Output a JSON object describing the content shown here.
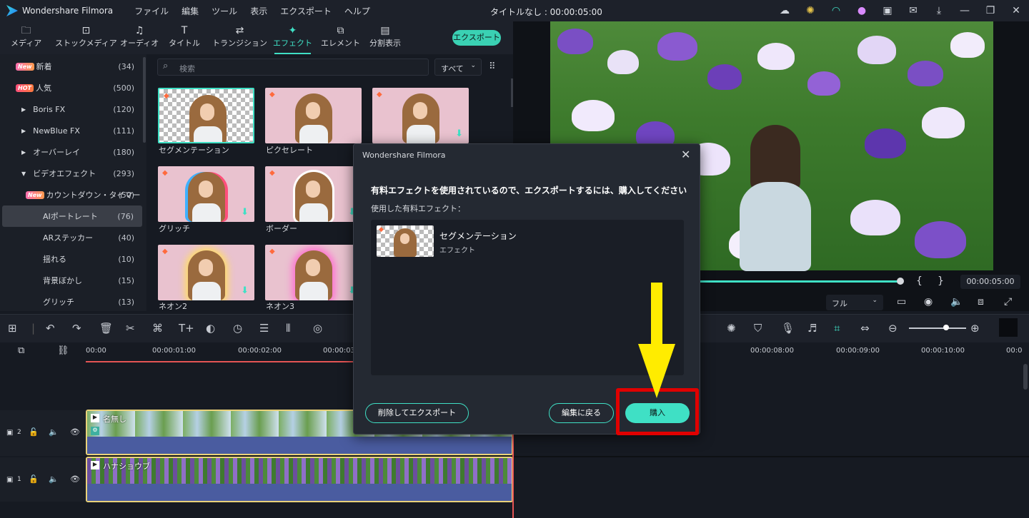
{
  "app": {
    "name": "Wondershare Filmora",
    "project_title": "タイトルなし : 00:00:05:00",
    "menus": [
      "ファイル",
      "編集",
      "ツール",
      "表示",
      "エクスポート",
      "ヘルプ"
    ]
  },
  "toolbar": {
    "tabs": [
      {
        "label": "メディア",
        "icon": "folder-icon"
      },
      {
        "label": "ストックメディア",
        "icon": "stock-media-icon"
      },
      {
        "label": "オーディオ",
        "icon": "music-note-icon"
      },
      {
        "label": "タイトル",
        "icon": "text-T-icon"
      },
      {
        "label": "トランジション",
        "icon": "transition-icon"
      },
      {
        "label": "エフェクト",
        "icon": "effects-icon"
      },
      {
        "label": "エレメント",
        "icon": "elements-icon"
      },
      {
        "label": "分割表示",
        "icon": "split-screen-icon"
      }
    ],
    "active_tab": "エフェクト",
    "export_label": "エクスポート"
  },
  "sidebar": {
    "items": [
      {
        "badge": "New",
        "label": "新着",
        "count": "(34)"
      },
      {
        "badge": "HOT",
        "label": "人気",
        "count": "(500)"
      },
      {
        "label": "Boris FX",
        "count": "(120)"
      },
      {
        "label": "NewBlue FX",
        "count": "(111)"
      },
      {
        "label": "オーバーレイ",
        "count": "(180)"
      },
      {
        "label": "ビデオエフェクト",
        "count": "(293)"
      },
      {
        "badge": "New",
        "label": "カウントダウン・タイマー",
        "count": "(50)"
      },
      {
        "label": "AIポートレート",
        "count": "(76)"
      },
      {
        "label": "ARステッカー",
        "count": "(40)"
      },
      {
        "label": "揺れる",
        "count": "(10)"
      },
      {
        "label": "背景ぼかし",
        "count": "(15)"
      },
      {
        "label": "グリッチ",
        "count": "(13)"
      }
    ]
  },
  "effects_panel": {
    "search_placeholder": "検索",
    "filter_value": "すべて",
    "items": [
      "セグメンテーション",
      "ピクセレート",
      "グリッチ",
      "ボーダー",
      "ネオン2",
      "ネオン3"
    ]
  },
  "preview": {
    "timecode": "00:00:05:00",
    "zoom_select": "フル",
    "bracket_in": "{",
    "bracket_out": "}"
  },
  "timeline": {
    "ruler": [
      "00:00",
      "00:00:01:00",
      "00:00:02:00",
      "00:00:03",
      "00:00:08:00",
      "00:00:09:00",
      "00:00:10:00",
      "00:0"
    ],
    "tracks": [
      {
        "number": "2",
        "clip_name": "名無し"
      },
      {
        "number": "1",
        "clip_name": "ハナショウブ"
      }
    ]
  },
  "dialog": {
    "title": "Wondershare Filmora",
    "message": "有料エフェクトを使用されているので、エクスポートするには、購入してください",
    "subheading": "使用した有料エフェクト：",
    "effect_name": "セグメンテーション",
    "effect_type": "エフェクト",
    "remove_export_label": "削除してエクスポート",
    "back_label": "編集に戻る",
    "buy_label": "購入"
  },
  "colors": {
    "accent": "#3fe0c5",
    "highlight_box": "#e00000",
    "arrow": "#ffec00"
  }
}
